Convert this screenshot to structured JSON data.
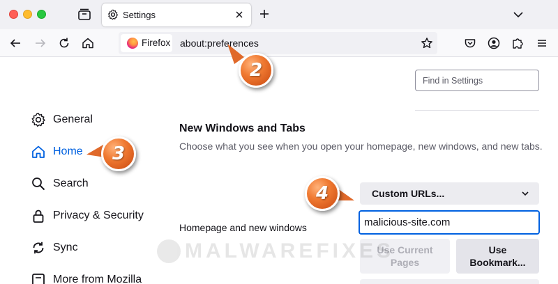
{
  "tab": {
    "title": "Settings"
  },
  "urlbar": {
    "identity_label": "Firefox",
    "url": "about:preferences"
  },
  "search": {
    "placeholder": "Find in Settings"
  },
  "sidebar": {
    "items": [
      {
        "label": "General",
        "icon": "gear-icon"
      },
      {
        "label": "Home",
        "icon": "home-icon",
        "selected": true
      },
      {
        "label": "Search",
        "icon": "search-icon"
      },
      {
        "label": "Privacy & Security",
        "icon": "lock-icon"
      },
      {
        "label": "Sync",
        "icon": "sync-icon"
      },
      {
        "label": "More from Mozilla",
        "icon": "mozilla-icon"
      }
    ]
  },
  "main": {
    "section_title": "New Windows and Tabs",
    "section_desc": "Choose what you see when you open your homepage, new windows, and new tabs.",
    "homepage_label": "Homepage and new windows",
    "homepage_mode": "Custom URLs...",
    "homepage_url": "malicious-site.com",
    "use_current_label_1": "Use Current",
    "use_current_label_2": "Pages",
    "use_bookmark_label_1": "Use",
    "use_bookmark_label_2": "Bookmark..."
  },
  "callouts": {
    "c2": "2",
    "c3": "3",
    "c4": "4"
  },
  "watermark": "MALWAREFIXES",
  "colors": {
    "accent": "#0061e0",
    "callout": "#f07a32"
  }
}
